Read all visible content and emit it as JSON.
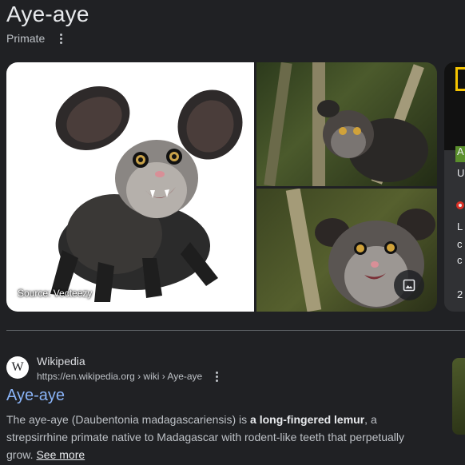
{
  "header": {
    "title": "Aye-aye",
    "subtitle": "Primate"
  },
  "gallery": {
    "main_image": {
      "alt": "Aye-aye",
      "source": "Source: Vecteezy"
    },
    "top_right_image": {
      "alt": "Aye-aye in tree"
    },
    "bottom_right_image": {
      "alt": "Aye-aye close-up"
    },
    "peek_card": {
      "letters": [
        "A",
        "U",
        "L",
        "c",
        "c",
        "2"
      ]
    },
    "more_images_icon": "image-icon"
  },
  "result": {
    "site_name": "Wikipedia",
    "favicon_letter": "W",
    "url": "https://en.wikipedia.org › wiki › Aye-aye",
    "title": "Aye-aye",
    "snippet_before": "The aye-aye (Daubentonia madagascariensis) is ",
    "snippet_bold": "a long-fingered lemur",
    "snippet_after": ", a strepsirrhine primate native to Madagascar with rodent-like teeth that perpetually grow.",
    "see_more": "See more"
  },
  "colors": {
    "background": "#202124",
    "link": "#8ab4f8",
    "text": "#e8eaed",
    "muted": "#bdc1c6"
  }
}
